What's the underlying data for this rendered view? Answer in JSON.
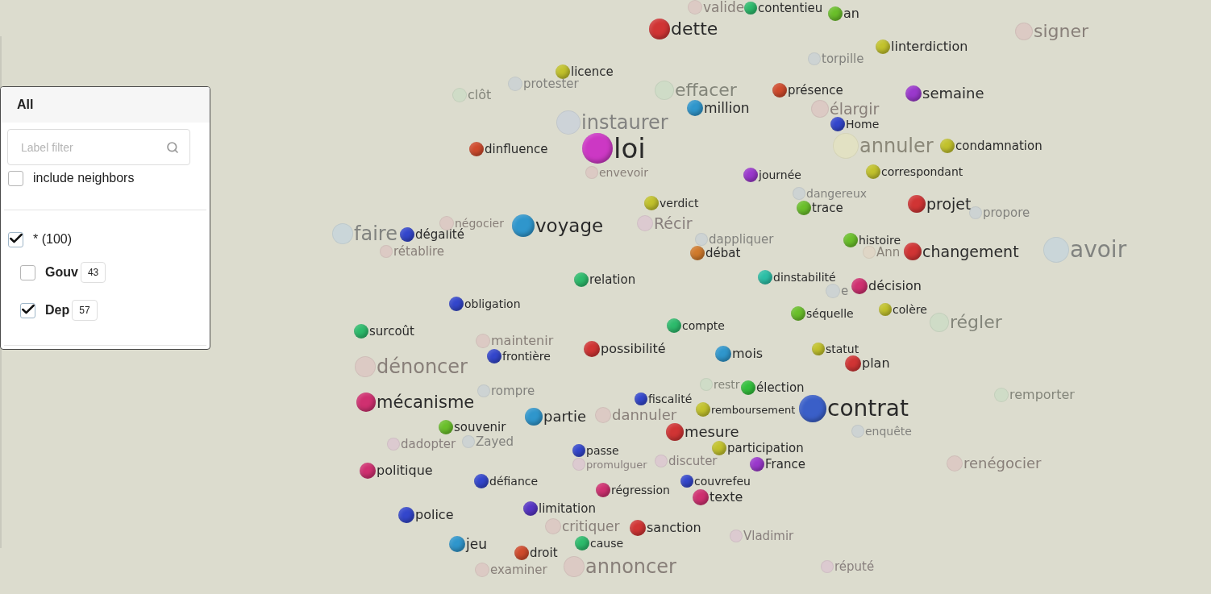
{
  "filter_panel": {
    "title": "All",
    "search": {
      "placeholder": "Label filter"
    },
    "include_neighbors": {
      "label": "include neighbors",
      "checked": false
    },
    "groups": [
      {
        "label": "* (100)",
        "checked": true,
        "children": [
          {
            "label": "Gouv",
            "count": "43",
            "checked": false
          },
          {
            "label": "Dep",
            "count": "57",
            "checked": true
          }
        ]
      }
    ]
  },
  "graph": {
    "nodes": [
      {
        "label": "valide",
        "color": "#dccac4",
        "dimmed": true
      },
      {
        "label": "contentieu",
        "color": "#2dbb6c",
        "dimmed": false
      },
      {
        "label": "an",
        "color": "#6abf2a",
        "dimmed": false
      },
      {
        "label": "dette",
        "color": "#d03434",
        "dimmed": false
      },
      {
        "label": "signer",
        "color": "#dccac4",
        "dimmed": true
      },
      {
        "label": "linterdiction",
        "color": "#c2c22c",
        "dimmed": false
      },
      {
        "label": "torpille",
        "color": "#cdd3d3",
        "dimmed": true
      },
      {
        "label": "licence",
        "color": "#c2c22c",
        "dimmed": false
      },
      {
        "label": "protester",
        "color": "#cdd3d3",
        "dimmed": true
      },
      {
        "label": "clôt",
        "color": "#cfdcc7",
        "dimmed": true
      },
      {
        "label": "effacer",
        "color": "#cfdcc7",
        "dimmed": true
      },
      {
        "label": "présence",
        "color": "#cf4a2c",
        "dimmed": false
      },
      {
        "label": "semaine",
        "color": "#9a38cc",
        "dimmed": false
      },
      {
        "label": "million",
        "color": "#2f96cc",
        "dimmed": false
      },
      {
        "label": "élargir",
        "color": "#dccac4",
        "dimmed": true
      },
      {
        "label": "instaurer",
        "color": "#cdd3d8",
        "dimmed": true
      },
      {
        "label": "Home",
        "color": "#3346cc",
        "dimmed": false
      },
      {
        "label": "dinfluence",
        "color": "#cf4a2c",
        "dimmed": false
      },
      {
        "label": "loi",
        "color": "#cc38c4",
        "dimmed": false
      },
      {
        "label": "annuler",
        "color": "#e2e1c3",
        "dimmed": true
      },
      {
        "label": "condamnation",
        "color": "#c2c22c",
        "dimmed": false
      },
      {
        "label": "envevoir",
        "color": "#dccac4",
        "dimmed": true
      },
      {
        "label": "journée",
        "color": "#9a38cc",
        "dimmed": false
      },
      {
        "label": "correspondant",
        "color": "#c2c22c",
        "dimmed": false
      },
      {
        "label": "verdict",
        "color": "#c2c22c",
        "dimmed": false
      },
      {
        "label": "dangereux",
        "color": "#cdd3d3",
        "dimmed": true
      },
      {
        "label": "trace",
        "color": "#6abf2a",
        "dimmed": false
      },
      {
        "label": "projet",
        "color": "#d03434",
        "dimmed": false
      },
      {
        "label": "propore",
        "color": "#cdd3d3",
        "dimmed": true
      },
      {
        "label": "faire",
        "color": "#cad6d9",
        "dimmed": true
      },
      {
        "label": "dégalité",
        "color": "#3346cc",
        "dimmed": false
      },
      {
        "label": "négocier",
        "color": "#dccac4",
        "dimmed": true
      },
      {
        "label": "voyage",
        "color": "#2f96cc",
        "dimmed": false
      },
      {
        "label": "Récir",
        "color": "#dccad0",
        "dimmed": true
      },
      {
        "label": "dappliquer",
        "color": "#cdd3d3",
        "dimmed": true
      },
      {
        "label": "histoire",
        "color": "#6abf2a",
        "dimmed": false
      },
      {
        "label": "rétablire",
        "color": "#dccac4",
        "dimmed": true
      },
      {
        "label": "débat",
        "color": "#d07a2c",
        "dimmed": false
      },
      {
        "label": "Ann",
        "color": "#dfd6c6",
        "dimmed": true
      },
      {
        "label": "changement",
        "color": "#d03434",
        "dimmed": false
      },
      {
        "label": "avoir",
        "color": "#cad6d9",
        "dimmed": true
      },
      {
        "label": "relation",
        "color": "#2dbb6c",
        "dimmed": false
      },
      {
        "label": "dinstabilité",
        "color": "#2cbfa6",
        "dimmed": false
      },
      {
        "label": "e",
        "color": "#cdd3d3",
        "dimmed": true
      },
      {
        "label": "décision",
        "color": "#cf3070",
        "dimmed": false
      },
      {
        "label": "obligation",
        "color": "#3346cc",
        "dimmed": false
      },
      {
        "label": "séquelle",
        "color": "#6abf2a",
        "dimmed": false
      },
      {
        "label": "colère",
        "color": "#c2c22c",
        "dimmed": false
      },
      {
        "label": "surcoût",
        "color": "#2dbb6c",
        "dimmed": false
      },
      {
        "label": "compte",
        "color": "#2dbb6c",
        "dimmed": false
      },
      {
        "label": "régler",
        "color": "#cfdcc7",
        "dimmed": true
      },
      {
        "label": "maintenir",
        "color": "#dccac4",
        "dimmed": true
      },
      {
        "label": "dénoncer",
        "color": "#dccac4",
        "dimmed": true
      },
      {
        "label": "frontière",
        "color": "#3346cc",
        "dimmed": false
      },
      {
        "label": "possibilité",
        "color": "#d03434",
        "dimmed": false
      },
      {
        "label": "mois",
        "color": "#2f96cc",
        "dimmed": false
      },
      {
        "label": "statut",
        "color": "#c2c22c",
        "dimmed": false
      },
      {
        "label": "plan",
        "color": "#d03434",
        "dimmed": false
      },
      {
        "label": "mécanisme",
        "color": "#cf3070",
        "dimmed": false
      },
      {
        "label": "rompre",
        "color": "#cdd3d3",
        "dimmed": true
      },
      {
        "label": "fiscalité",
        "color": "#3346cc",
        "dimmed": false
      },
      {
        "label": "restr",
        "color": "#cfdcc7",
        "dimmed": true
      },
      {
        "label": "élection",
        "color": "#33bf3c",
        "dimmed": false
      },
      {
        "label": "remporter",
        "color": "#cfdcc7",
        "dimmed": true
      },
      {
        "label": "partie",
        "color": "#2f96cc",
        "dimmed": false
      },
      {
        "label": "dannuler",
        "color": "#dccac4",
        "dimmed": true
      },
      {
        "label": "remboursement",
        "color": "#c2c22c",
        "dimmed": false
      },
      {
        "label": "contrat",
        "color": "#3a5fc8",
        "dimmed": false
      },
      {
        "label": "souvenir",
        "color": "#6abf2a",
        "dimmed": false
      },
      {
        "label": "mesure",
        "color": "#d03434",
        "dimmed": false
      },
      {
        "label": "enquête",
        "color": "#cdd3d3",
        "dimmed": true
      },
      {
        "label": "dadopter",
        "color": "#dccad0",
        "dimmed": true
      },
      {
        "label": "Zayed",
        "color": "#cdd3d3",
        "dimmed": true
      },
      {
        "label": "passe",
        "color": "#3346cc",
        "dimmed": false
      },
      {
        "label": "participation",
        "color": "#c2c22c",
        "dimmed": false
      },
      {
        "label": "politique",
        "color": "#cf3070",
        "dimmed": false
      },
      {
        "label": "promulguer",
        "color": "#dccad0",
        "dimmed": true
      },
      {
        "label": "discuter",
        "color": "#dccad0",
        "dimmed": true
      },
      {
        "label": "France",
        "color": "#9a38cc",
        "dimmed": false
      },
      {
        "label": "renégocier",
        "color": "#dccac4",
        "dimmed": true
      },
      {
        "label": "défiance",
        "color": "#3346cc",
        "dimmed": false
      },
      {
        "label": "régression",
        "color": "#cf3070",
        "dimmed": false
      },
      {
        "label": "couvrefeu",
        "color": "#3346cc",
        "dimmed": false
      },
      {
        "label": "texte",
        "color": "#cf3070",
        "dimmed": false
      },
      {
        "label": "police",
        "color": "#3346cc",
        "dimmed": false
      },
      {
        "label": "limitation",
        "color": "#5634c4",
        "dimmed": false
      },
      {
        "label": "critiquer",
        "color": "#dccac4",
        "dimmed": true
      },
      {
        "label": "sanction",
        "color": "#d03434",
        "dimmed": false
      },
      {
        "label": "jeu",
        "color": "#2f96cc",
        "dimmed": false
      },
      {
        "label": "cause",
        "color": "#2dbb6c",
        "dimmed": false
      },
      {
        "label": "Vladimir",
        "color": "#dccad0",
        "dimmed": true
      },
      {
        "label": "droit",
        "color": "#cf4a2c",
        "dimmed": false
      },
      {
        "label": "examiner",
        "color": "#dccac4",
        "dimmed": true
      },
      {
        "label": "annoncer",
        "color": "#dccac4",
        "dimmed": true
      },
      {
        "label": "réputé",
        "color": "#dccad0",
        "dimmed": true
      }
    ]
  }
}
